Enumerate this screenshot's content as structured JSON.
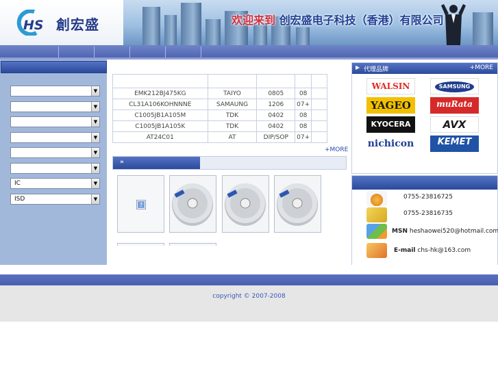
{
  "header": {
    "logo_mark": "HS",
    "logo_cn": "創宏盛",
    "welcome_prefix": "欢迎来到",
    "welcome_company": "创宏盛电子科技（香港）有限公司",
    "banner_subtext": "· · ·"
  },
  "sidebar": {
    "selects": [
      {
        "value": ""
      },
      {
        "value": ""
      },
      {
        "value": ""
      },
      {
        "value": ""
      },
      {
        "value": ""
      },
      {
        "value": ""
      },
      {
        "value": "IC"
      },
      {
        "value": "ISD"
      }
    ]
  },
  "parts": {
    "rows": [
      [
        "",
        "",
        "",
        ""
      ],
      [
        "EMK212BJ475KG",
        "TAIYO",
        "0805",
        "08"
      ],
      [
        "CL31A106KOHNNNE",
        "SAMAUNG",
        "1206",
        "07+"
      ],
      [
        "C1005JB1A105M",
        "TDK",
        "0402",
        "08"
      ],
      [
        "C1005JB1A105K",
        "TDK",
        "0402",
        "08"
      ],
      [
        "AT24C01",
        "AT",
        "DIP/SOP",
        "07+"
      ]
    ],
    "more": "+MORE"
  },
  "products": {
    "arrow": "»",
    "missing_icon": "?"
  },
  "brands": {
    "title": "代理品牌",
    "more": "+MORE",
    "items": [
      {
        "name": "WALSIN",
        "color": "#e02a22",
        "bg": "#ffffff"
      },
      {
        "name": "SAMSUNG",
        "color": "#1f3d8f",
        "bg": "#ffffff"
      },
      {
        "name": "YAGEO",
        "color": "#1a1a1a",
        "bg": "#f2c000"
      },
      {
        "name": "muRata",
        "color": "#ffffff",
        "bg": "#d52a2a"
      },
      {
        "name": "KYOCERA",
        "color": "#ffffff",
        "bg": "#111111"
      },
      {
        "name": "AVX",
        "color": "#1a1a1a",
        "bg": "#ffffff"
      },
      {
        "name": "nichicon",
        "color": "#1f3f94",
        "bg": "#ffffff"
      },
      {
        "name": "KEMET",
        "color": "#ffffff",
        "bg": "#2052a6"
      }
    ]
  },
  "contact": {
    "phone1": "0755-23816725",
    "phone2": "0755-23816735",
    "msn_label": "MSN",
    "msn_value": "heshaowei520@hotmail.com",
    "email_label": "E-mail",
    "email_value": "chs-hk@163.com"
  },
  "footer": {
    "copyright": "copyright © 2007-2008"
  },
  "colors": {
    "nav": "#4c62b0",
    "sidebar": "#a2b8db",
    "accent": "#2c4a9c",
    "footer_bg": "#e6e6e6"
  }
}
